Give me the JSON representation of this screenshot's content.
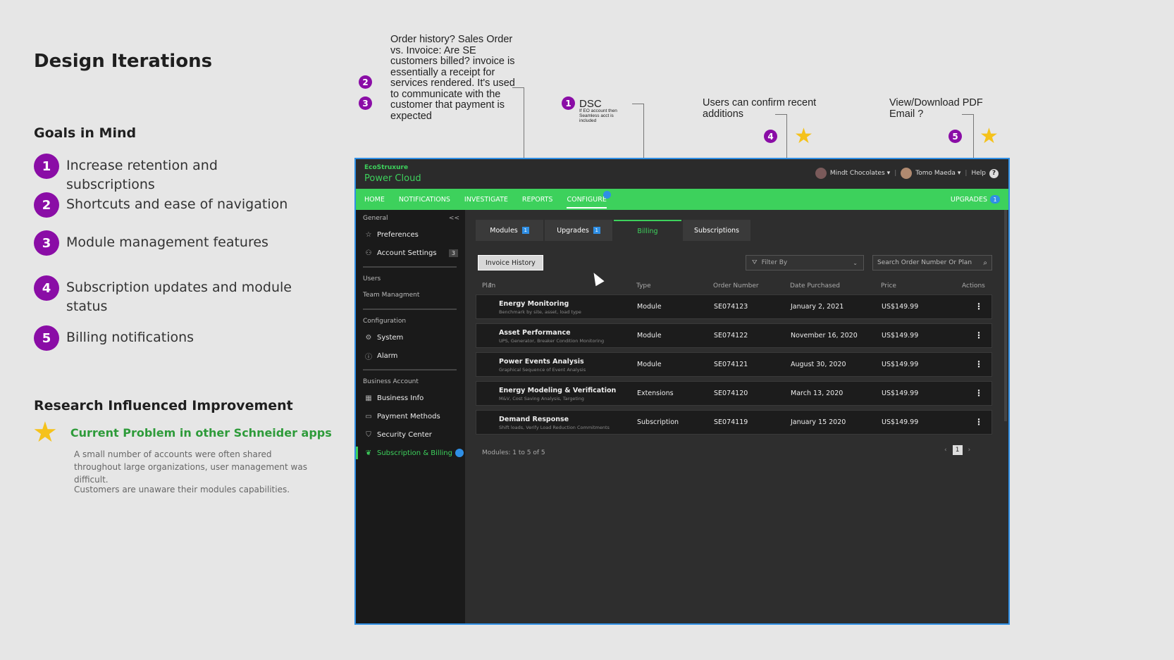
{
  "page": {
    "title": "Design Iterations",
    "goals_title": "Goals in Mind",
    "goals": [
      {
        "num": "1",
        "text": "Increase retention and subscriptions"
      },
      {
        "num": "2",
        "text": "Shortcuts and ease of navigation"
      },
      {
        "num": "3",
        "text": "Module management features"
      },
      {
        "num": "4",
        "text": "Subscription updates and module status"
      },
      {
        "num": "5",
        "text": "Billing notifications"
      }
    ],
    "research_title": "Research Influenced Improvement",
    "problem_title": "Current Problem in other Schneider apps",
    "problem_desc_1": "A small number of accounts were often shared throughout large organizations, user management was difficult.",
    "problem_desc_2": "Customers are unaware their modules capabilities."
  },
  "annotations": {
    "order_history": "Order history? Sales Order vs. Invoice: Are SE customers billed? invoice is essentially a receipt for services rendered. It's used to communicate with the customer that payment is expected",
    "badge_2": "2",
    "badge_3": "3",
    "badge_1": "1",
    "dsc_title": "DSC",
    "dsc_note": "If EO account then Seamless acct is included",
    "confirm": "Users can confirm recent additions",
    "badge_4": "4",
    "pdf": "View/Download PDF Email ?",
    "badge_5": "5"
  },
  "app": {
    "brand_small": "EcoStruxure",
    "brand_big": "Power Cloud",
    "org": "Mindt Chocolates",
    "user": "Tomo Maeda",
    "help": "Help",
    "help_icon": "?",
    "nav": [
      "HOME",
      "NOTIFICATIONS",
      "INVESTIGATE",
      "REPORTS",
      "CONFIGURE"
    ],
    "nav_upgrades": "UPGRADES",
    "nav_upgrades_count": "1",
    "sidebar": {
      "general": "General",
      "preferences": "Preferences",
      "account_settings": "Account Settings",
      "account_settings_count": "3",
      "users": "Users",
      "team_management": "Team Managment",
      "configuration": "Configuration",
      "system": "System",
      "alarm": "Alarm",
      "business_account": "Business Account",
      "business_info": "Business Info",
      "payment_methods": "Payment Methods",
      "security_center": "Security Center",
      "subscription_billing": "Subscription & Billing"
    },
    "tabs": [
      {
        "label": "Modules",
        "count": "1"
      },
      {
        "label": "Upgrades",
        "count": "1"
      },
      {
        "label": "Billing",
        "count": ""
      },
      {
        "label": "Subscriptions",
        "count": ""
      }
    ],
    "invoice_history": "Invoice History",
    "filter_placeholder": "Filter By",
    "search_placeholder": "Search Order Number Or Plan",
    "columns": {
      "plan": "Plan",
      "type": "Type",
      "order": "Order Number",
      "date": "Date Purchased",
      "price": "Price",
      "actions": "Actions"
    },
    "rows": [
      {
        "plan": "Energy Monitoring",
        "sub": "Benchmark by site, asset, load type",
        "type": "Module",
        "order": "SE074123",
        "date": "January 2, 2021",
        "price": "US$149.99"
      },
      {
        "plan": "Asset Performance",
        "sub": "UPS, Generator, Breaker Condition Monitoring",
        "type": "Module",
        "order": "SE074122",
        "date": "November 16, 2020",
        "price": "US$149.99"
      },
      {
        "plan": "Power Events Analysis",
        "sub": "Graphical Sequence of Event Analysis",
        "type": "Module",
        "order": "SE074121",
        "date": "August 30, 2020",
        "price": "US$149.99"
      },
      {
        "plan": "Energy Modeling & Verification",
        "sub": "M&V, Cost Saving Analysis, Targeting",
        "type": "Extensions",
        "order": "SE074120",
        "date": "March 13, 2020",
        "price": "US$149.99"
      },
      {
        "plan": "Demand Response",
        "sub": "Shift loads, Verify Load Reduction Commitments",
        "type": "Subscription",
        "order": "SE074119",
        "date": "January 15 2020",
        "price": "US$149.99"
      }
    ],
    "footer": "Modules: 1 to 5 of 5",
    "page_number": "1"
  },
  "colors": {
    "accent_green": "#3dd15c",
    "badge_purple": "#8a0da6",
    "star": "#f5c21b",
    "window_border": "#2f8fe5"
  }
}
